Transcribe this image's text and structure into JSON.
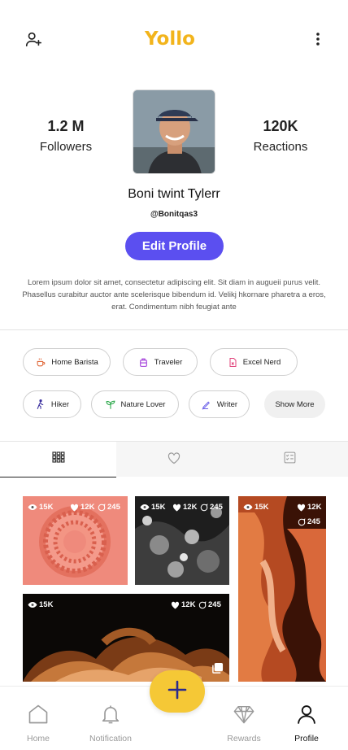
{
  "header": {
    "logo_text": "Yollo",
    "add_user_icon": "add-user-icon",
    "more_icon": "more-vertical-icon"
  },
  "profile": {
    "followers_count": "1.2 M",
    "followers_label": "Followers",
    "reactions_count": "120K",
    "reactions_label": "Reactions",
    "name": "Boni twint Tylerr",
    "handle": "@Bonitqas3",
    "edit_label": "Edit Profile",
    "bio": "Lorem ipsum dolor sit amet, consectetur adipiscing elit. Sit diam in augueii purus velit. Phasellus curabitur auctor ante scelerisque bibendum id. Velikj hkornare pharetra a eros, erat. Condimentum nibh feugiat ante"
  },
  "interests": [
    {
      "label": "Home Barista",
      "icon": "coffee-icon",
      "color": "#e0683a"
    },
    {
      "label": "Traveler",
      "icon": "luggage-icon",
      "color": "#a13bd9"
    },
    {
      "label": "Excel Nerd",
      "icon": "spreadsheet-icon",
      "color": "#e0417a"
    },
    {
      "label": "Hiker",
      "icon": "hiker-icon",
      "color": "#3a2f9e"
    },
    {
      "label": "Nature Lover",
      "icon": "leaf-icon",
      "color": "#2ba84a"
    },
    {
      "label": "Writer",
      "icon": "pen-icon",
      "color": "#6a5ee8"
    },
    {
      "label": "Show More",
      "icon": "",
      "color": ""
    }
  ],
  "tabs": [
    {
      "name": "grid",
      "icon": "grid-icon",
      "active": true
    },
    {
      "name": "likes",
      "icon": "heart-icon",
      "active": false
    },
    {
      "name": "checklist",
      "icon": "checklist-icon",
      "active": false
    }
  ],
  "posts": [
    {
      "views": "15K",
      "likes": "12K",
      "comments": "245"
    },
    {
      "views": "15K",
      "likes": "12K",
      "comments": "245"
    },
    {
      "views": "15K",
      "likes": "12K",
      "comments": "245"
    },
    {
      "views": "15K",
      "likes": "12K",
      "comments": "245"
    }
  ],
  "bottom_nav": [
    {
      "label": "Home",
      "icon": "home-icon",
      "active": false
    },
    {
      "label": "Notification",
      "icon": "bell-icon",
      "active": false
    },
    {
      "label": "Rewards",
      "icon": "diamond-icon",
      "active": false
    },
    {
      "label": "Profile",
      "icon": "profile-icon",
      "active": true
    }
  ],
  "fab_icon": "plus-icon",
  "colors": {
    "accent": "#5b4ff0",
    "brand": "#f2b41c",
    "fab": "#f5c836"
  }
}
